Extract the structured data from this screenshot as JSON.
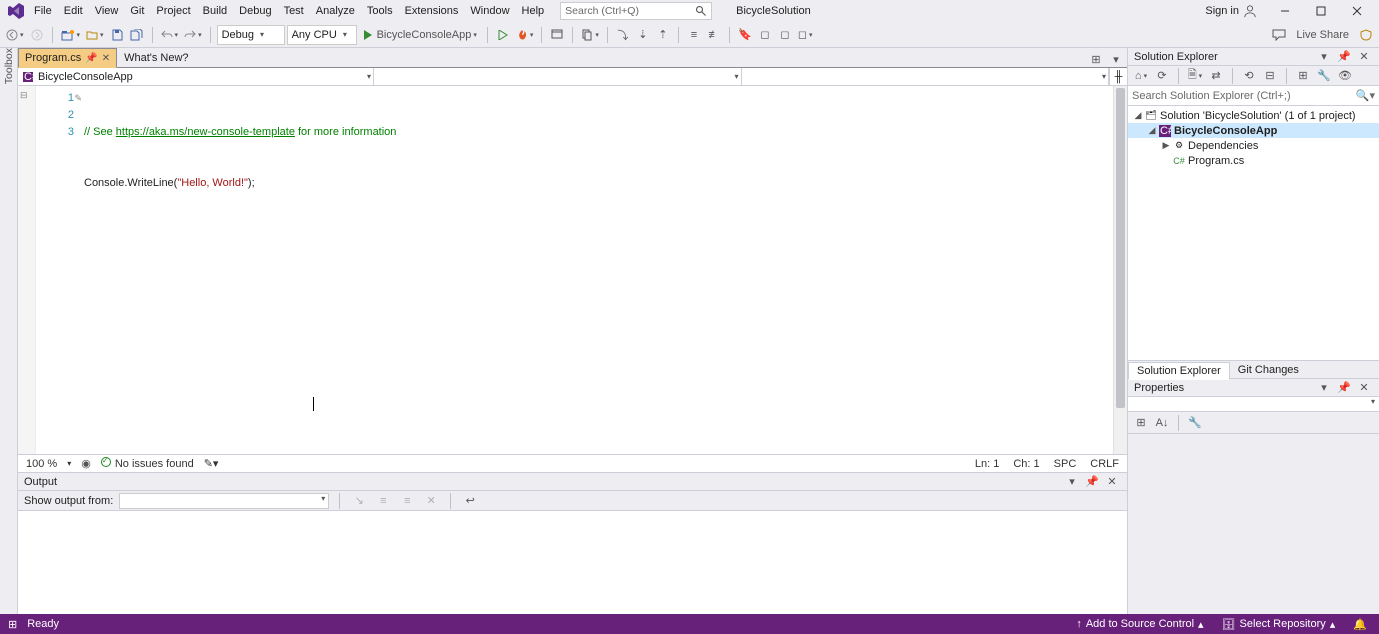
{
  "title": {
    "solution": "BicycleSolution",
    "signin": "Sign in"
  },
  "menu": {
    "file": "File",
    "edit": "Edit",
    "view": "View",
    "git": "Git",
    "project": "Project",
    "build": "Build",
    "debug": "Debug",
    "test": "Test",
    "analyze": "Analyze",
    "tools": "Tools",
    "extensions": "Extensions",
    "window": "Window",
    "help": "Help"
  },
  "search": {
    "placeholder": "Search (Ctrl+Q)"
  },
  "toolbar": {
    "config": "Debug",
    "platform": "Any CPU",
    "start_target": "BicycleConsoleApp",
    "live_share": "Live Share"
  },
  "tabs": {
    "t0": "Program.cs",
    "t1": "What's New?"
  },
  "navbar": {
    "project": "BicycleConsoleApp"
  },
  "code": {
    "l1_a": "// See ",
    "l1_url": "https://aka.ms/new-console-template",
    "l1_b": " for more information",
    "l2_a": "Console.WriteLine(",
    "l2_str": "\"Hello, World!\"",
    "l2_b": ");"
  },
  "lines": {
    "n1": "1",
    "n2": "2",
    "n3": "3"
  },
  "editor_status": {
    "zoom": "100 %",
    "issues": "No issues found",
    "ln": "Ln: 1",
    "ch": "Ch: 1",
    "spc": "SPC",
    "crlf": "CRLF"
  },
  "output": {
    "title": "Output",
    "show_from": "Show output from:"
  },
  "solution_explorer": {
    "title": "Solution Explorer",
    "search_placeholder": "Search Solution Explorer (Ctrl+;)",
    "root": "Solution 'BicycleSolution' (1 of 1 project)",
    "project": "BicycleConsoleApp",
    "deps": "Dependencies",
    "program": "Program.cs",
    "tab_se": "Solution Explorer",
    "tab_git": "Git Changes"
  },
  "properties": {
    "title": "Properties"
  },
  "toolbox": {
    "label": "Toolbox"
  },
  "statusbar": {
    "ready": "Ready",
    "add_src": "Add to Source Control",
    "select_repo": "Select Repository"
  }
}
